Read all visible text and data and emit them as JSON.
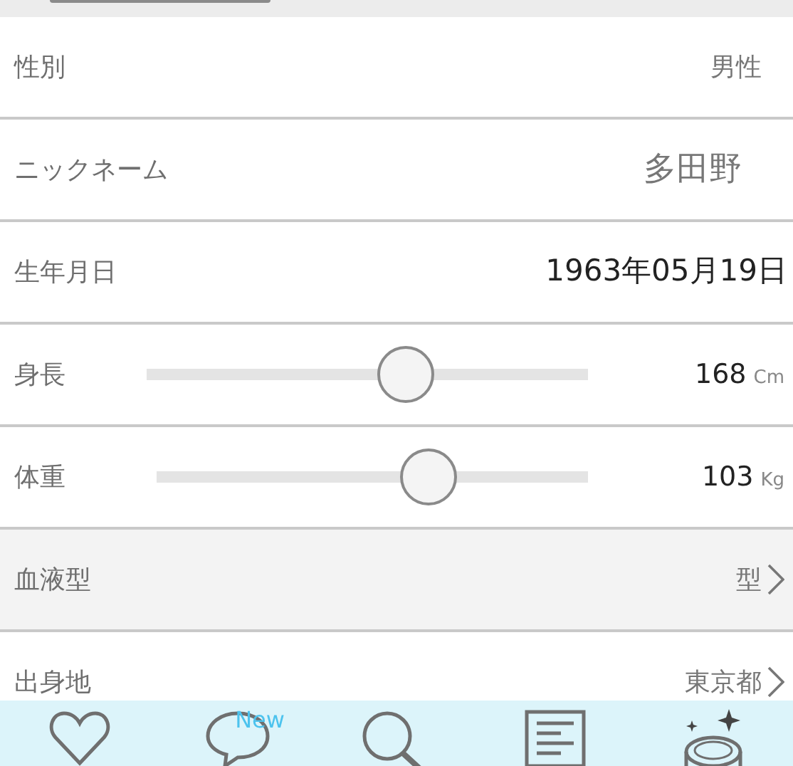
{
  "rows": [
    {
      "kind": "text",
      "label": "性別",
      "value": "男性"
    },
    {
      "kind": "text",
      "label": "ニックネーム",
      "value": "多田野"
    },
    {
      "kind": "text",
      "label": "生年月日",
      "value": "1963年05月19日"
    },
    {
      "kind": "slider",
      "label": "身長",
      "level": 0.6,
      "reading": "168",
      "unit": "Cm"
    },
    {
      "kind": "slider",
      "label": "体重",
      "level": 0.65,
      "reading": "103",
      "unit": "Kg"
    },
    {
      "kind": "link",
      "label": "血液型",
      "value": "型",
      "selected": true
    },
    {
      "kind": "link",
      "label": "出身地",
      "value": "東京都",
      "selected": false
    }
  ],
  "tab_bar": {
    "badge": "New"
  }
}
